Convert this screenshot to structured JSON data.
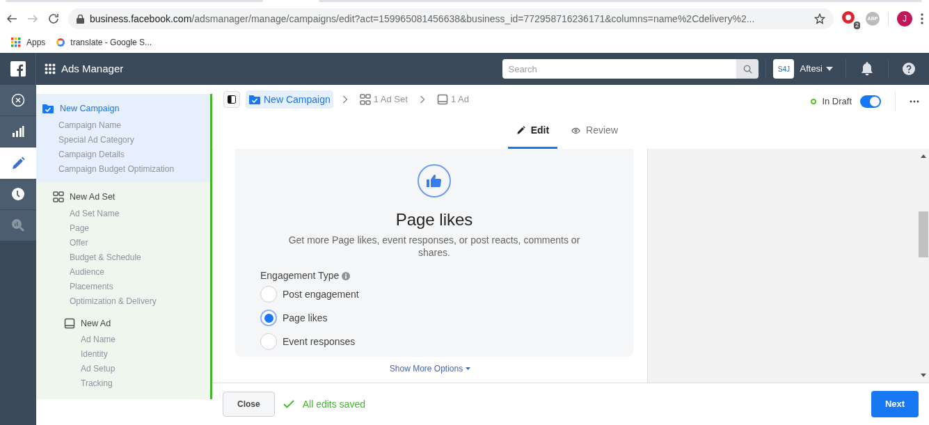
{
  "browser": {
    "url_host": "business.facebook.com",
    "url_path": "/adsmanager/manage/campaigns/edit?act=159965081456638&business_id=772958716236171&columns=name%2Cdelivery%2...",
    "extension_badge": "2",
    "adblock_label": "ABP",
    "profile_initial": "J",
    "bookmarks": [
      {
        "kind": "apps",
        "label": "Apps"
      },
      {
        "kind": "google",
        "label": "translate - Google S..."
      }
    ]
  },
  "header": {
    "title": "Ads Manager",
    "search": {
      "placeholder": "Search"
    },
    "account_logo": "S4J",
    "account_name": "Aftesi"
  },
  "rail": [
    {
      "kind": "close",
      "selected": false
    },
    {
      "kind": "chart",
      "selected": false
    },
    {
      "kind": "edit",
      "selected": true
    },
    {
      "kind": "clock",
      "selected": false
    },
    {
      "kind": "search",
      "selected": false
    }
  ],
  "nav": {
    "title": "New Campaign",
    "selected": true,
    "items": [
      "Campaign Name",
      "Special Ad Category",
      "Campaign Details",
      "Campaign Budget Optimization"
    ],
    "children": [
      {
        "title": "New Ad Set",
        "items": [
          "Ad Set Name",
          "Page",
          "Offer",
          "Budget & Schedule",
          "Audience",
          "Placements",
          "Optimization & Delivery"
        ],
        "children": [
          {
            "title": "New Ad",
            "items": [
              "Ad Name",
              "Identity",
              "Ad Setup",
              "Tracking"
            ]
          }
        ]
      }
    ]
  },
  "breadcrumb": [
    {
      "kind": "campaign",
      "label": "New Campaign",
      "selected": true
    },
    {
      "kind": "adset",
      "label": "1 Ad Set",
      "selected": false
    },
    {
      "kind": "ad",
      "label": "1 Ad",
      "selected": false
    }
  ],
  "status": {
    "label": "In Draft",
    "on": true
  },
  "tabs": [
    {
      "kind": "edit",
      "label": "Edit",
      "selected": true
    },
    {
      "kind": "review",
      "label": "Review",
      "selected": false
    }
  ],
  "card": {
    "title": "Page likes",
    "description": "Get more Page likes, event responses, or post reacts, comments or shares.",
    "field_label": "Engagement Type",
    "options": [
      {
        "label": "Post engagement",
        "selected": false
      },
      {
        "label": "Page likes",
        "selected": true
      },
      {
        "label": "Event responses",
        "selected": false
      }
    ]
  },
  "show_more": "Show More Options",
  "footer": {
    "close": "Close",
    "saved": "All edits saved",
    "next": "Next"
  }
}
